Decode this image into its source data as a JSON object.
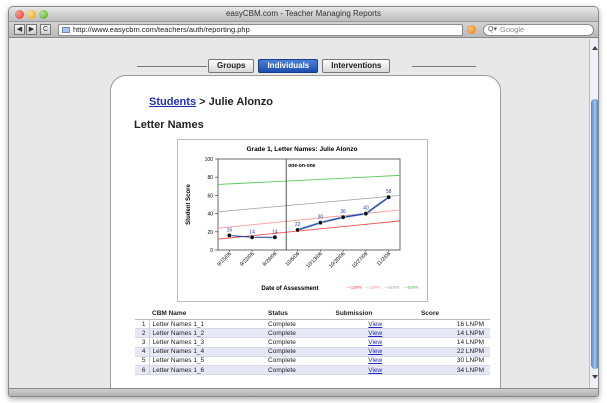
{
  "window": {
    "title": "easyCBM.com - Teacher Managing Reports"
  },
  "browser": {
    "url": "http://www.easycbm.com/teachers/auth/reporting.php",
    "search_placeholder": "Google",
    "back_label": "◀",
    "forward_label": "▶",
    "reload_label": "C"
  },
  "tabs": [
    {
      "label": "Groups",
      "active": false
    },
    {
      "label": "Individuals",
      "active": true
    },
    {
      "label": "Interventions",
      "active": false
    }
  ],
  "breadcrumb": {
    "link": "Students",
    "separator": " > ",
    "current": "Julie Alonzo"
  },
  "section_title": "Letter Names",
  "chart_data": {
    "type": "line",
    "title": "Grade 1, Letter Names: Julie Alonzo",
    "xlabel": "Date of Assessment",
    "ylabel": "Student Score",
    "ylim": [
      0,
      100
    ],
    "yticks": [
      0,
      20,
      40,
      60,
      80,
      100
    ],
    "x": [
      "9/15/06",
      "9/22/06",
      "9/29/06",
      "10/6/06",
      "10/13/06",
      "10/20/06",
      "10/27/06",
      "11/2/06"
    ],
    "series": [
      {
        "name": "Student Score",
        "values": [
          16,
          14,
          14,
          22,
          30,
          36,
          40,
          58
        ],
        "color": "#1a3d9c"
      }
    ],
    "trend_line": {
      "start_index": 3,
      "values": [
        22,
        30,
        36,
        40,
        58
      ],
      "color": "#7aa0e6"
    },
    "intervention_marker": {
      "index": 2.5,
      "label": "one-on-one"
    },
    "percentile_lines": [
      {
        "name": "10PR",
        "start": 12,
        "end": 32,
        "color": "#ff4a4a"
      },
      {
        "name": "20PR",
        "start": 24,
        "end": 44,
        "color": "#ff9a9a"
      },
      {
        "name": "50PR",
        "start": 42,
        "end": 60,
        "color": "#aaaaaa"
      },
      {
        "name": "90PR",
        "start": 72,
        "end": 82,
        "color": "#59c959"
      }
    ],
    "legend": {
      "placement": "bottom-right",
      "items": [
        "—10PR",
        "—20PR",
        "—50PR",
        "—90PR"
      ]
    },
    "grid": false
  },
  "table": {
    "headers": [
      "",
      "CBM Name",
      "Status",
      "Submission",
      "Score"
    ],
    "rows": [
      {
        "num": "1",
        "name": "Letter Names 1_1",
        "status": "Complete",
        "submission": "View",
        "score": "16 LNPM"
      },
      {
        "num": "2",
        "name": "Letter Names 1_2",
        "status": "Complete",
        "submission": "View",
        "score": "14 LNPM"
      },
      {
        "num": "3",
        "name": "Letter Names 1_3",
        "status": "Complete",
        "submission": "View",
        "score": "14 LNPM"
      },
      {
        "num": "4",
        "name": "Letter Names 1_4",
        "status": "Complete",
        "submission": "View",
        "score": "22 LNPM"
      },
      {
        "num": "5",
        "name": "Letter Names 1_5",
        "status": "Complete",
        "submission": "View",
        "score": "30 LNPM"
      },
      {
        "num": "6",
        "name": "Letter Names 1_6",
        "status": "Complete",
        "submission": "View",
        "score": "34 LNPM"
      }
    ]
  }
}
